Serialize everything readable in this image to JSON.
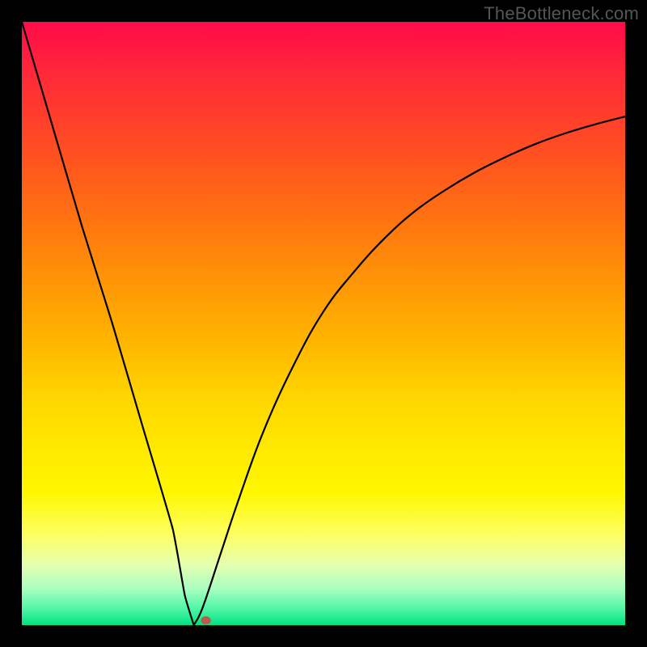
{
  "watermark": "TheBottleneck.com",
  "chart_data": {
    "type": "line",
    "title": "",
    "xlabel": "",
    "ylabel": "",
    "xlim": [
      0,
      100
    ],
    "ylim": [
      0,
      100
    ],
    "grid": false,
    "series": [
      {
        "name": "curve",
        "x": [
          0,
          5,
          10,
          15,
          20,
          25,
          27,
          28.5,
          30,
          33,
          36,
          40,
          45,
          50,
          55,
          60,
          65,
          70,
          75,
          80,
          85,
          90,
          95,
          100
        ],
        "values": [
          100,
          83,
          66,
          50,
          33,
          16,
          5,
          0,
          3,
          12,
          21,
          32,
          43,
          52,
          58.5,
          64,
          68.5,
          72,
          75,
          77.5,
          79.7,
          81.5,
          83,
          84.3
        ]
      }
    ],
    "min_point": {
      "x": 28.5,
      "y": 0
    },
    "marker": {
      "x": 30.5,
      "y": 0.8,
      "color": "#bb5b4b"
    },
    "background_gradient": {
      "top": "#ff0b4a",
      "bottom": "#00e283"
    }
  }
}
